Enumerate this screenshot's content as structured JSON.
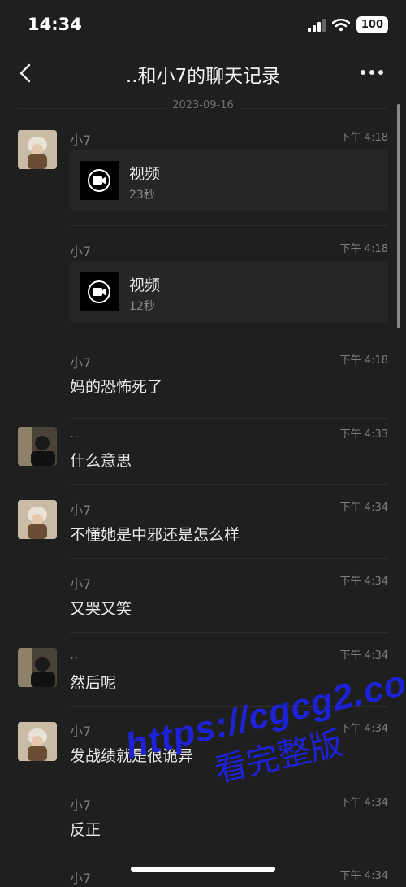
{
  "status_bar": {
    "time": "14:34",
    "battery": "100"
  },
  "nav": {
    "title": "..和小7的聊天记录"
  },
  "date_divider": "2023-09-16",
  "messages": [
    {
      "sender": "小7",
      "time": "下午 4:18",
      "type": "video",
      "video_label": "视频",
      "duration": "23秒",
      "avatar": "girl"
    },
    {
      "sender": "小7",
      "time": "下午 4:18",
      "type": "video",
      "video_label": "视频",
      "duration": "12秒"
    },
    {
      "sender": "小7",
      "time": "下午 4:18",
      "type": "text",
      "text": "妈的恐怖死了"
    },
    {
      "sender": "..",
      "time": "下午 4:33",
      "type": "text",
      "text": "什么意思",
      "avatar": "boy"
    },
    {
      "sender": "小7",
      "time": "下午 4:34",
      "type": "text",
      "text": "不懂她是中邪还是怎么样",
      "avatar": "girl"
    },
    {
      "sender": "小7",
      "time": "下午 4:34",
      "type": "text",
      "text": "又哭又笑"
    },
    {
      "sender": "..",
      "time": "下午 4:34",
      "type": "text",
      "text": "然后呢",
      "avatar": "boy"
    },
    {
      "sender": "小7",
      "time": "下午 4:34",
      "type": "text",
      "text": "发战绩就是很诡异",
      "avatar": "girl"
    },
    {
      "sender": "小7",
      "time": "下午 4:34",
      "type": "text",
      "text": "反正"
    },
    {
      "sender": "小7",
      "time": "下午 4:34",
      "type": "text",
      "text": ""
    }
  ],
  "watermark": {
    "url": "https://cgcg2.co",
    "text": "看完整版"
  }
}
